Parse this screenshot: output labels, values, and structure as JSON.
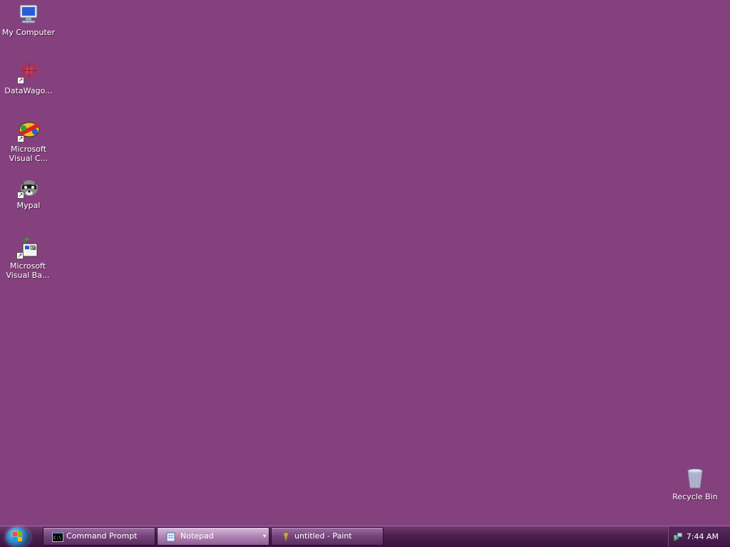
{
  "desktop": {
    "background_color": "#85407e",
    "icons": [
      {
        "label": "My Computer",
        "icon": "computer-icon",
        "shortcut": false
      },
      {
        "label": "DataWago...",
        "icon": "datawagon-icon",
        "shortcut": true
      },
      {
        "label": "Microsoft\nVisual C...",
        "icon": "visual-c-icon",
        "shortcut": true
      },
      {
        "label": "Mypal",
        "icon": "mypal-icon",
        "shortcut": true
      },
      {
        "label": "Microsoft\nVisual Ba...",
        "icon": "visual-basic-icon",
        "shortcut": true
      },
      {
        "label": "Recycle Bin",
        "icon": "recycle-bin-icon",
        "shortcut": false
      }
    ]
  },
  "taskbar": {
    "start_button": "start-orb-icon",
    "tasks": [
      {
        "label": "Command Prompt",
        "icon": "command-prompt-icon",
        "active": false
      },
      {
        "label": "Notepad",
        "icon": "notepad-icon",
        "active": true
      },
      {
        "label": "untitled - Paint",
        "icon": "paint-icon",
        "active": false
      }
    ],
    "tray": {
      "icon": "network-icon",
      "clock": "7:44 AM"
    }
  }
}
